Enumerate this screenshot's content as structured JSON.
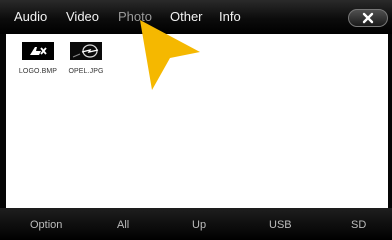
{
  "tabs": [
    {
      "label": "Audio"
    },
    {
      "label": "Video"
    },
    {
      "label": "Photo",
      "active": true
    },
    {
      "label": "Other"
    },
    {
      "label": "Info"
    }
  ],
  "close_icon": "close-x-icon",
  "files": [
    {
      "name": "LOGO.BMP",
      "icon": "logo-thumbnail"
    },
    {
      "name": "OPEL.JPG",
      "icon": "photo-thumbnail"
    }
  ],
  "bottom_bar": {
    "option": "Option",
    "all": "All",
    "up": "Up",
    "usb": "USB",
    "sd": "SD"
  },
  "colors": {
    "arrow": "#f5b800",
    "panel": "#ffffff",
    "active_tab": "#9a9a9a"
  }
}
